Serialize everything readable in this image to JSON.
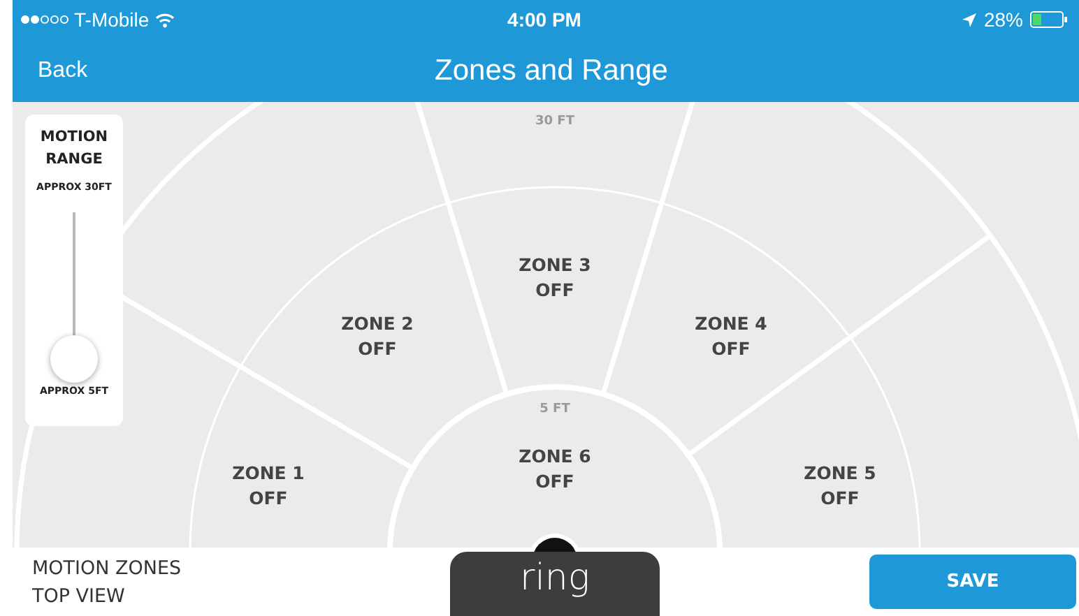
{
  "status_bar": {
    "carrier": "T-Mobile",
    "time": "4:00 PM",
    "battery": "28%"
  },
  "nav": {
    "back": "Back",
    "title": "Zones and Range"
  },
  "distance_labels": {
    "outer": "30 FT",
    "inner": "5 FT"
  },
  "zones": [
    {
      "name": "ZONE 1",
      "status": "OFF"
    },
    {
      "name": "ZONE 2",
      "status": "OFF"
    },
    {
      "name": "ZONE 3",
      "status": "OFF"
    },
    {
      "name": "ZONE 4",
      "status": "OFF"
    },
    {
      "name": "ZONE 5",
      "status": "OFF"
    },
    {
      "name": "ZONE 6",
      "status": "OFF"
    }
  ],
  "range_slider": {
    "title": "MOTION RANGE",
    "max_label": "APPROX 30FT",
    "min_label": "APPROX 5FT",
    "level": 0
  },
  "footer": {
    "caption": [
      "MOTION ZONES",
      "TOP VIEW"
    ],
    "logo": "ring",
    "save": "SAVE"
  }
}
